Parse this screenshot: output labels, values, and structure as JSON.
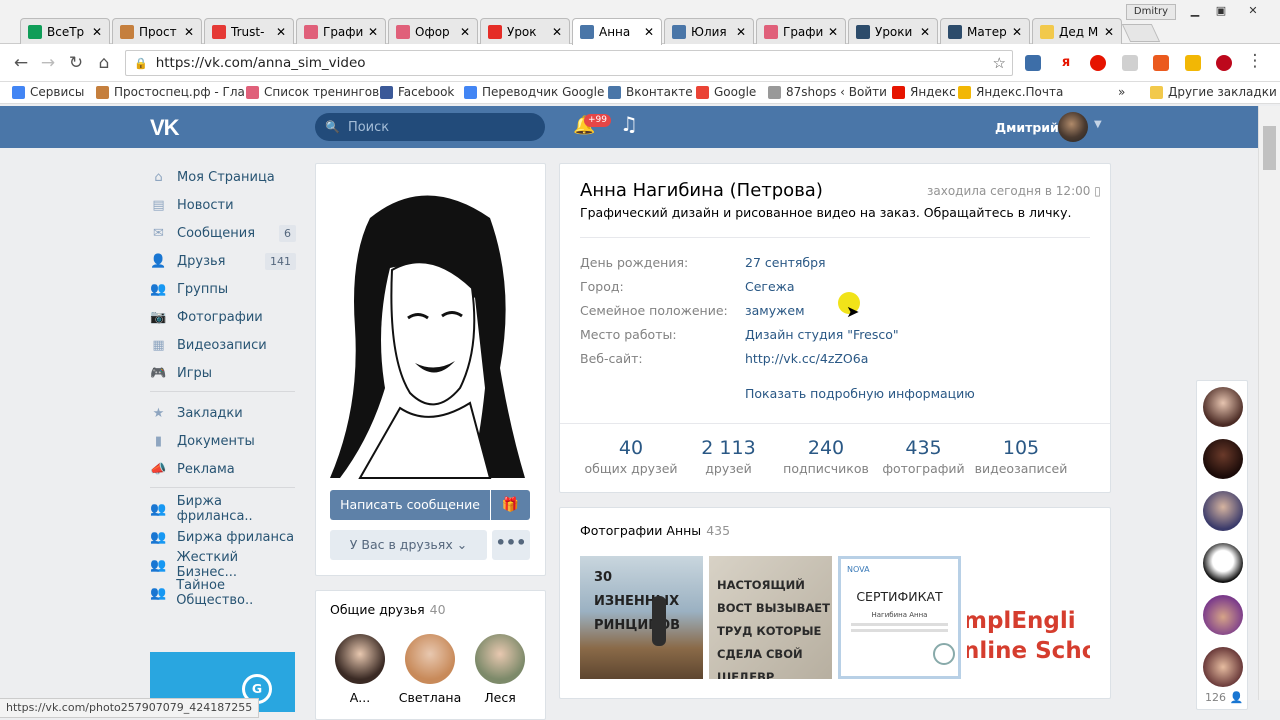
{
  "browser": {
    "tabs": [
      {
        "label": "ВсеТр",
        "color": "#0f9d58"
      },
      {
        "label": "Прост",
        "color": "#c57f3d"
      },
      {
        "label": "Trust-",
        "color": "#e53935"
      },
      {
        "label": "Графи",
        "color": "#e0607a"
      },
      {
        "label": "Офор",
        "color": "#e0607a"
      },
      {
        "label": "Урок",
        "color": "#e52d27"
      },
      {
        "label": "Анна",
        "color": "#4a76a8"
      },
      {
        "label": "Юлия",
        "color": "#4a76a8"
      },
      {
        "label": "Графи",
        "color": "#e0607a"
      },
      {
        "label": "Уроки",
        "color": "#2d4c6b"
      },
      {
        "label": "Матер",
        "color": "#2d4c6b"
      },
      {
        "label": "Дед М",
        "color": "#f2c94c"
      }
    ],
    "user_tag": "Dmitry",
    "url": "https://vk.com/anna_sim_video",
    "bookmarks": [
      {
        "label": "Сервисы",
        "color": "#4285f4"
      },
      {
        "label": "Простоспец.рф - Гла",
        "color": "#c57f3d"
      },
      {
        "label": "Список тренингов",
        "color": "#e0607a"
      },
      {
        "label": "Facebook",
        "color": "#3b5998"
      },
      {
        "label": "Переводчик Google",
        "color": "#4285f4"
      },
      {
        "label": "Вконтакте",
        "color": "#4a76a8"
      },
      {
        "label": "Google",
        "color": "#ea4335"
      },
      {
        "label": "87shops ‹ Войти",
        "color": "#999999"
      },
      {
        "label": "Яндекс",
        "color": "#e61400"
      },
      {
        "label": "Яндекс.Почта",
        "color": "#f2b705"
      }
    ],
    "bookmarks_other": "Другие закладки",
    "status_url": "https://vk.com/photo257907079_424187255"
  },
  "vk": {
    "logo": "VK",
    "search_placeholder": "Поиск",
    "notif_badge": "+99",
    "user_name": "Дмитрий",
    "menu": [
      {
        "label": "Моя Страница",
        "icon": "home-icon",
        "glyph": "⌂",
        "count": ""
      },
      {
        "label": "Новости",
        "icon": "news-icon",
        "glyph": "▤",
        "count": ""
      },
      {
        "label": "Сообщения",
        "icon": "messages-icon",
        "glyph": "✉",
        "count": "6"
      },
      {
        "label": "Друзья",
        "icon": "friends-icon",
        "glyph": "👤",
        "count": "141"
      },
      {
        "label": "Группы",
        "icon": "groups-icon",
        "glyph": "👥",
        "count": ""
      },
      {
        "label": "Фотографии",
        "icon": "camera-icon",
        "glyph": "📷",
        "count": ""
      },
      {
        "label": "Видеозаписи",
        "icon": "video-icon",
        "glyph": "▦",
        "count": ""
      },
      {
        "label": "Игры",
        "icon": "games-icon",
        "glyph": "🎮",
        "count": ""
      }
    ],
    "menu2": [
      {
        "label": "Закладки",
        "icon": "star-icon",
        "glyph": "★"
      },
      {
        "label": "Документы",
        "icon": "document-icon",
        "glyph": "▮"
      },
      {
        "label": "Реклама",
        "icon": "megaphone-icon",
        "glyph": "📣"
      }
    ],
    "menu3": [
      {
        "label": "Биржа фриланса..",
        "icon": "group-icon",
        "glyph": "👥"
      },
      {
        "label": "Биржа фриланса",
        "icon": "group-icon",
        "glyph": "👥"
      },
      {
        "label": "Жесткий Бизнес...",
        "icon": "group-icon",
        "glyph": "👥"
      },
      {
        "label": "Тайное Общество..",
        "icon": "group-icon",
        "glyph": "👥"
      }
    ],
    "profile": {
      "name": "Анна Нагибина (Петрова)",
      "last_seen": "заходила сегодня в 12:00",
      "status": "Графический дизайн и рисованное видео на заказ. Обращайтесь в личку.",
      "info": [
        {
          "k": "День рождения:",
          "v": "27 сентября"
        },
        {
          "k": "Город:",
          "v": "Сегежа"
        },
        {
          "k": "Семейное положение:",
          "v": "замужем"
        },
        {
          "k": "Место работы:",
          "v": "Дизайн студия \"Fresco\""
        },
        {
          "k": "Веб-сайт:",
          "v": "http://vk.cc/4zZO6a"
        }
      ],
      "more_info": "Показать подробную информацию",
      "counters": [
        {
          "n": "40",
          "l": "общих друзей"
        },
        {
          "n": "2 113",
          "l": "друзей"
        },
        {
          "n": "240",
          "l": "подписчиков"
        },
        {
          "n": "435",
          "l": "фотографий"
        },
        {
          "n": "105",
          "l": "видеозаписей"
        }
      ],
      "send_message": "Написать сообщение",
      "in_friends": "У Вас в друзьях",
      "more_dots": "•••",
      "gift_glyph": "🎁",
      "mutual_title": "Общие друзья",
      "mutual_count": "40",
      "mutual": [
        {
          "name": "А...",
          "color": "#3a2a24"
        },
        {
          "name": "Светлана",
          "color": "#c88a5a"
        },
        {
          "name": "Леся",
          "color": "#7d8a6a"
        }
      ],
      "photos_title": "Фотографии Анны",
      "photos_count": "435",
      "photo_texts": [
        "30 ИЗНЕННЫХ РИНЦИПОВ",
        "НАСТОЯЩИЙ ВОСТ ВЫЗЫВАЕТ ТРУД КОТОРЫЕ СДЕЛА СВОЙ ШЕДЕВР",
        "СЕРТИФИКАТ",
        "mplEngli nline Scho"
      ],
      "cert_brand": "NOVA",
      "cert_name": "Нагибина Анна"
    },
    "rail_count": "126"
  }
}
